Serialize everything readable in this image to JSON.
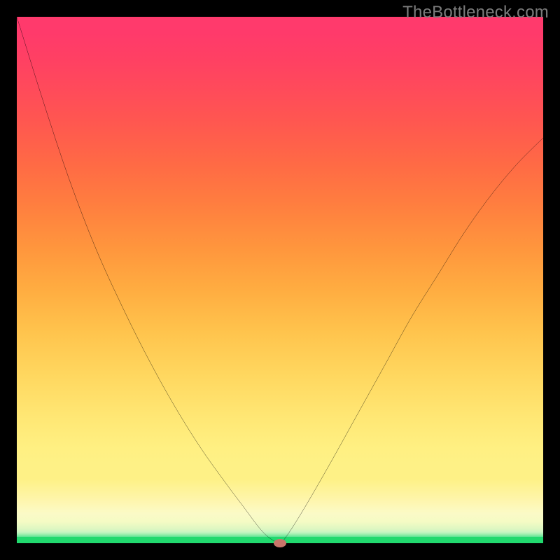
{
  "watermark": "TheBottleneck.com",
  "chart_data": {
    "type": "line",
    "title": "",
    "xlabel": "",
    "ylabel": "",
    "xlim": [
      0,
      100
    ],
    "ylim": [
      0,
      100
    ],
    "grid": false,
    "legend": false,
    "background_gradient": {
      "top": "#ff3a6d",
      "mid": "#fef186",
      "bottom": "#21d96e"
    },
    "series": [
      {
        "name": "bottleneck-curve",
        "color": "#000000",
        "x": [
          0,
          5,
          10,
          15,
          20,
          25,
          30,
          35,
          40,
          43,
          46,
          48,
          50,
          51,
          53,
          56,
          60,
          65,
          70,
          75,
          80,
          85,
          90,
          95,
          100
        ],
        "y": [
          100,
          84,
          69,
          56,
          45,
          35,
          26,
          18,
          11,
          7,
          3,
          1,
          0,
          1,
          4,
          9,
          16,
          25,
          34,
          43,
          51,
          59,
          66,
          72,
          77
        ]
      }
    ],
    "marker": {
      "name": "optimal-point",
      "color": "#c9756a",
      "x": 50,
      "y": 0
    }
  }
}
